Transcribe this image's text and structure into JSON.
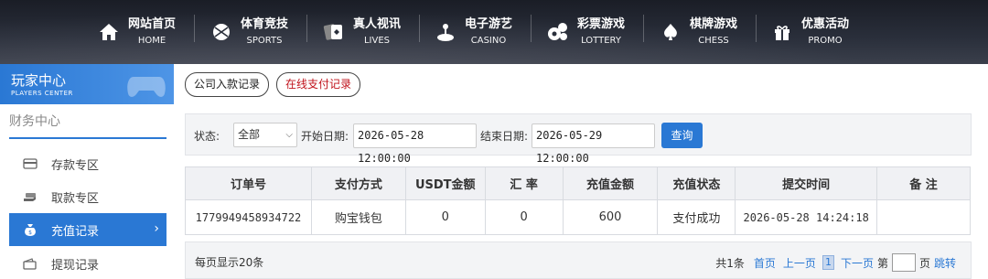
{
  "nav": [
    {
      "cn": "网站首页",
      "en": "HOME",
      "icon": "home-icon"
    },
    {
      "cn": "体育竞技",
      "en": "SPORTS",
      "icon": "ball-icon"
    },
    {
      "cn": "真人视讯",
      "en": "LIVES",
      "icon": "cards-icon"
    },
    {
      "cn": "电子游艺",
      "en": "CASINO",
      "icon": "joystick-icon"
    },
    {
      "cn": "彩票游戏",
      "en": "LOTTERY",
      "icon": "lottery-balls-icon"
    },
    {
      "cn": "棋牌游戏",
      "en": "CHESS",
      "icon": "spade-icon"
    },
    {
      "cn": "优惠活动",
      "en": "PROMO",
      "icon": "gift-icon"
    }
  ],
  "sidebar": {
    "title_cn": "玩家中心",
    "title_en": "PLAYERS CENTER",
    "section": "财务中心",
    "items": [
      {
        "label": "存款专区",
        "icon": "card-icon"
      },
      {
        "label": "取款专区",
        "icon": "cash-icon"
      },
      {
        "label": "充值记录",
        "icon": "moneybag-icon",
        "active": true
      },
      {
        "label": "提现记录",
        "icon": "wallet-icon"
      }
    ],
    "accent": "#2a78d4"
  },
  "tabs": [
    {
      "label": "公司入款记录"
    },
    {
      "label": "在线支付记录",
      "active": true
    }
  ],
  "filter": {
    "status_label": "状态:",
    "status_value": "全部",
    "start_label": "开始日期:",
    "start_value": "2026-05-28 12:00:00",
    "end_label": "结束日期:",
    "end_value": "2026-05-29 12:00:00",
    "query_label": "查询"
  },
  "table": {
    "headers": [
      "订单号",
      "支付方式",
      "USDT金额",
      "汇 率",
      "充值金额",
      "充值状态",
      "提交时间",
      "备 注"
    ],
    "rows": [
      [
        "1779949458934722",
        "购宝钱包",
        "0",
        "0",
        "600",
        "支付成功",
        "2026-05-28 14:24:18",
        ""
      ]
    ]
  },
  "pager": {
    "per_page": "每页显示20条",
    "total": "共1条",
    "first": "首页",
    "prev": "上一页",
    "current": "1",
    "next": "下一页",
    "page_prefix": "第",
    "page_suffix": "页",
    "jump": "跳转"
  }
}
